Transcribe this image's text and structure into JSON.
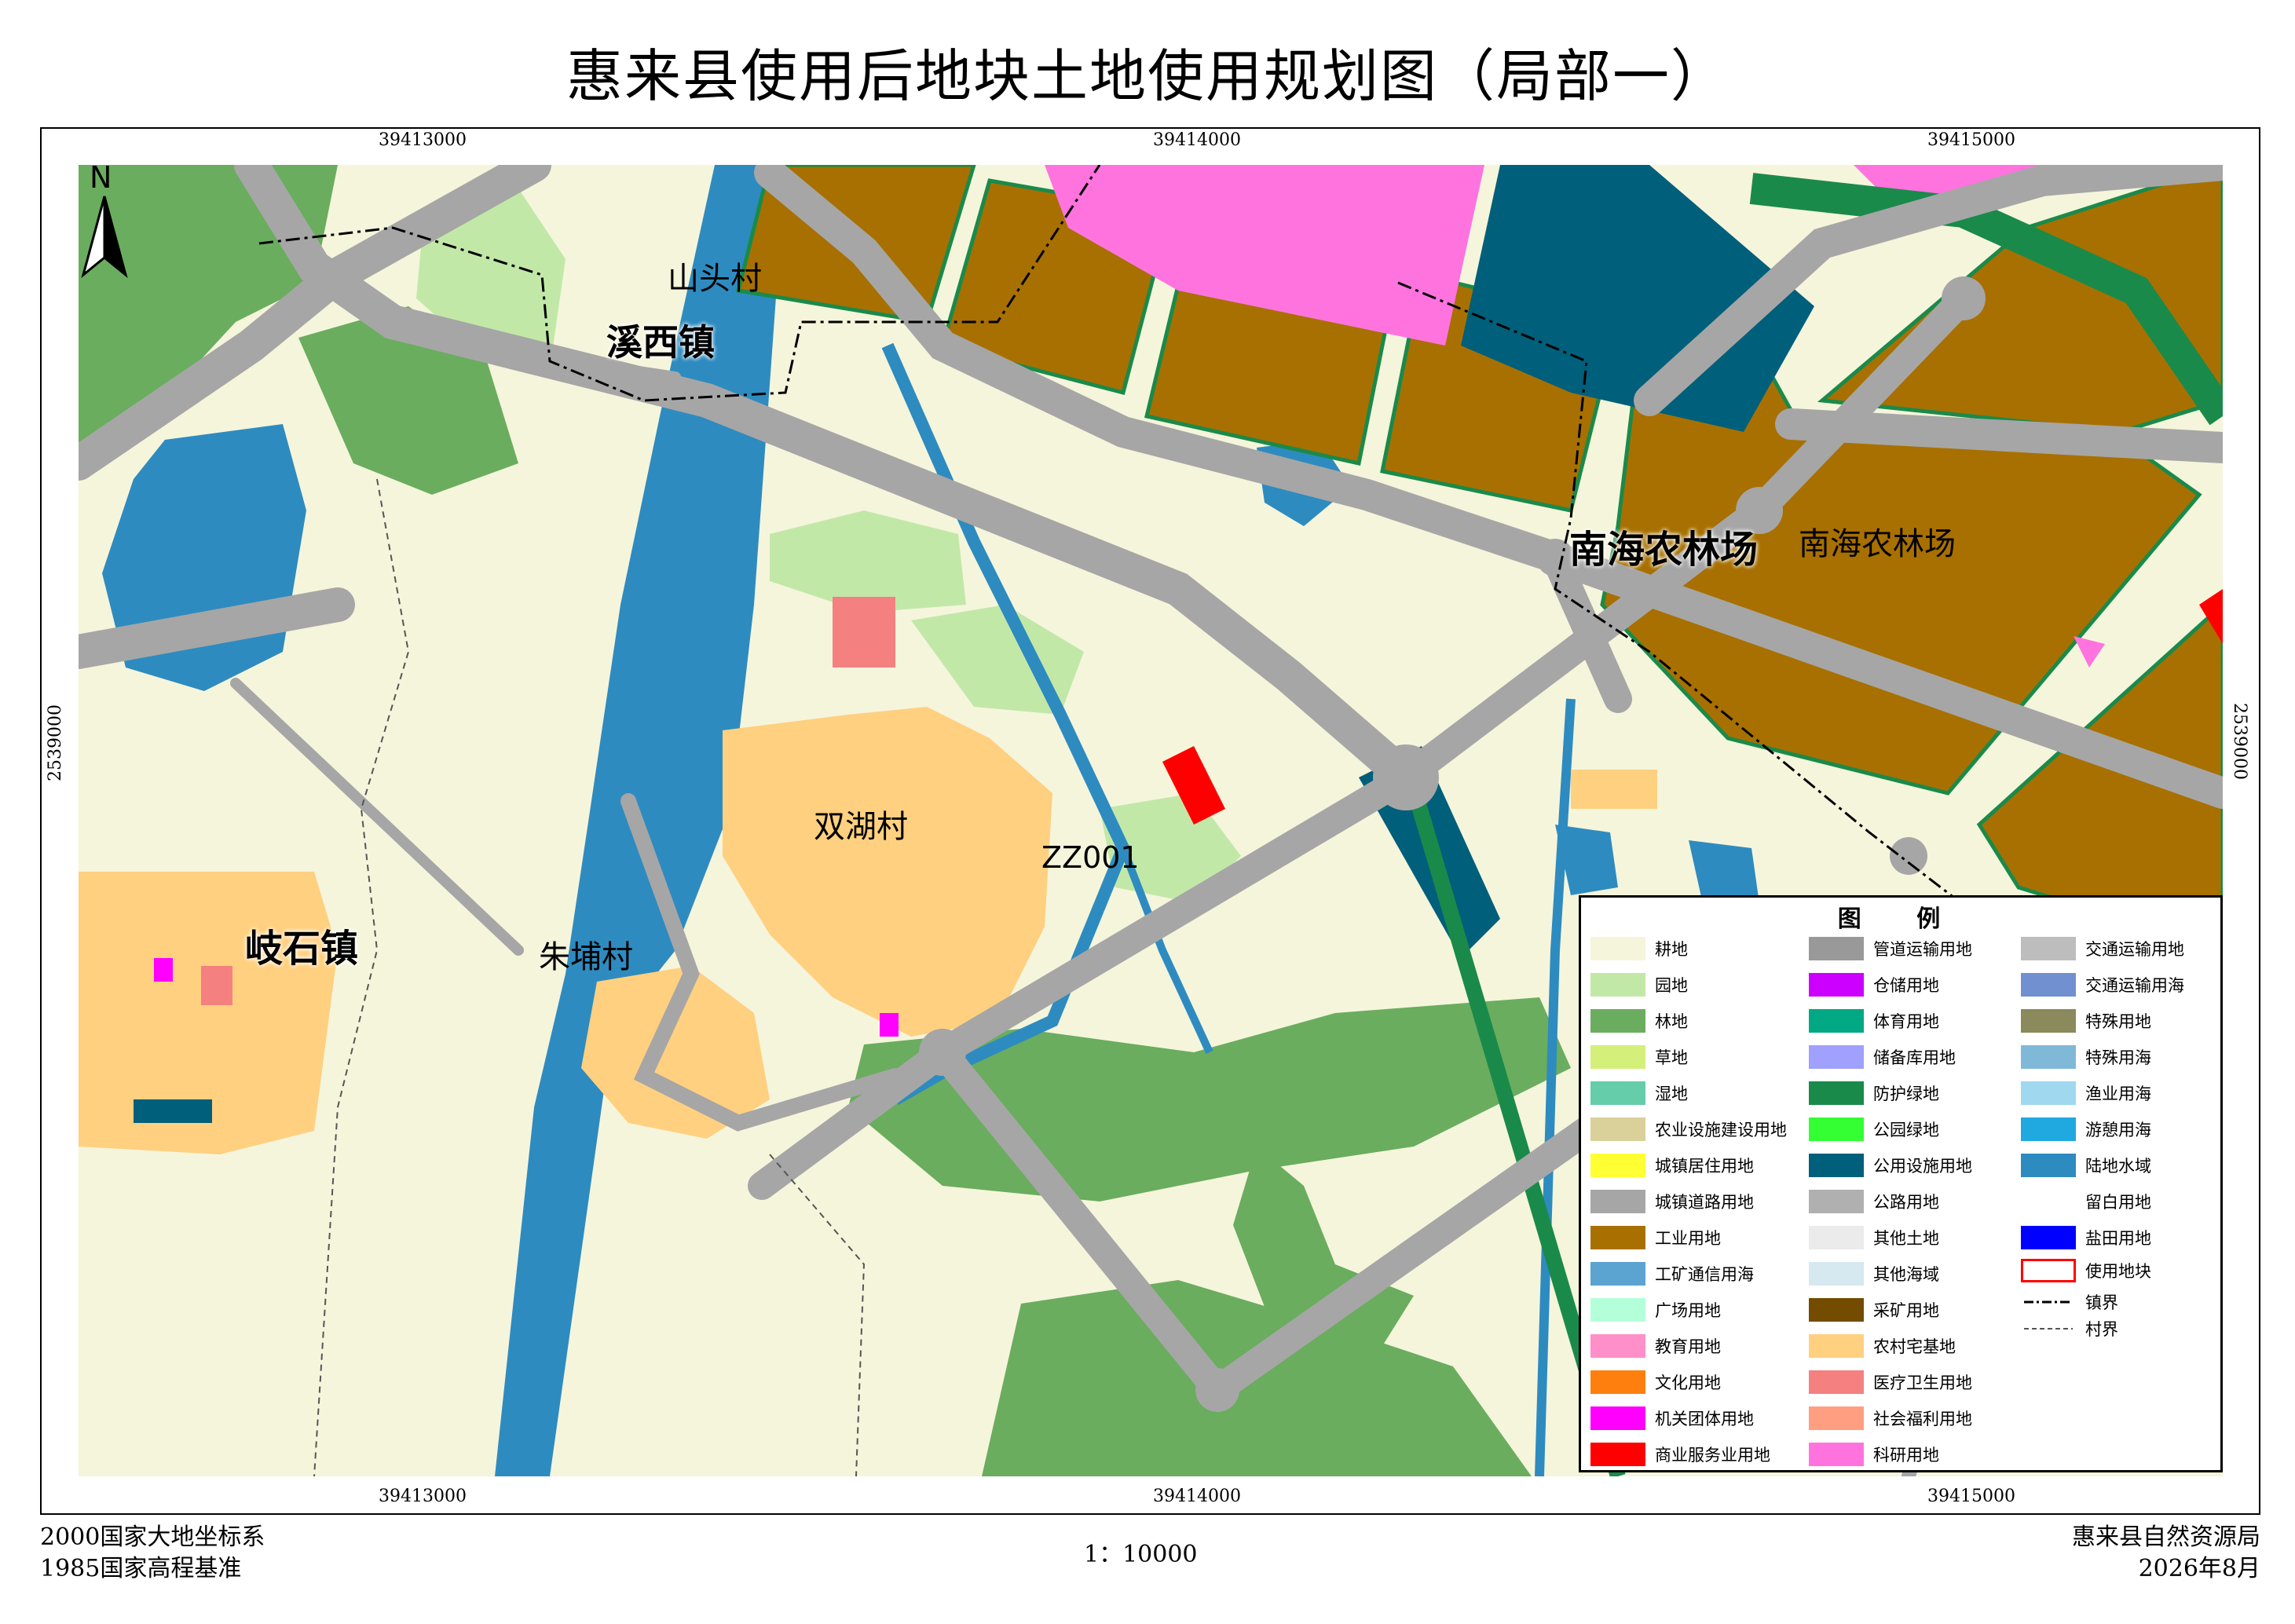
{
  "title": "惠来县使用后地块土地使用规划图（局部一）",
  "map": {
    "x_coords": [
      "39413000",
      "39414000",
      "39415000"
    ],
    "y_coords": [
      "2539000"
    ],
    "labels": {
      "xixi_town": "溪西镇",
      "shantou_village": "山头村",
      "nanhai_farm_bold": "南海农林场",
      "nanhai_farm": "南海农林场",
      "shuanghu_village": "双湖村",
      "parcel_id": "ZZ001",
      "qishi_town": "岐石镇",
      "zhupu_village": "朱埔村"
    },
    "north_label": "N"
  },
  "legend": {
    "title": "图 例",
    "col1": [
      {
        "label": "耕地",
        "color": "#f5f5dc"
      },
      {
        "label": "园地",
        "color": "#c2e8a8"
      },
      {
        "label": "林地",
        "color": "#6aad5e"
      },
      {
        "label": "草地",
        "color": "#d4f07a"
      },
      {
        "label": "湿地",
        "color": "#66cdaa"
      },
      {
        "label": "农业设施建设用地",
        "color": "#d9d09a"
      },
      {
        "label": "城镇居住用地",
        "color": "#ffff33"
      },
      {
        "label": "城镇道路用地",
        "color": "#a6a6a6"
      },
      {
        "label": "工业用地",
        "color": "#a87000"
      },
      {
        "label": "工矿通信用海",
        "color": "#5ba3d0"
      },
      {
        "label": "广场用地",
        "color": "#b3ffd9"
      },
      {
        "label": "教育用地",
        "color": "#ff8fc8"
      },
      {
        "label": "文化用地",
        "color": "#ff7f0e"
      },
      {
        "label": "机关团体用地",
        "color": "#ff00ff"
      },
      {
        "label": "商业服务业用地",
        "color": "#ff0000"
      }
    ],
    "col2": [
      {
        "label": "管道运输用地",
        "color": "#999999"
      },
      {
        "label": "仓储用地",
        "color": "#cc00ff"
      },
      {
        "label": "体育用地",
        "color": "#00a884"
      },
      {
        "label": "储备库用地",
        "color": "#a0a0ff"
      },
      {
        "label": "防护绿地",
        "color": "#1a8a4a"
      },
      {
        "label": "公园绿地",
        "color": "#33ff33"
      },
      {
        "label": "公用设施用地",
        "color": "#005f7a"
      },
      {
        "label": "公路用地",
        "color": "#b0b0b0"
      },
      {
        "label": "其他土地",
        "color": "#ebebeb"
      },
      {
        "label": "其他海域",
        "color": "#d6e8f0"
      },
      {
        "label": "采矿用地",
        "color": "#734c00"
      },
      {
        "label": "农村宅基地",
        "color": "#ffd080"
      },
      {
        "label": "医疗卫生用地",
        "color": "#f58080"
      },
      {
        "label": "社会福利用地",
        "color": "#ff9e80"
      },
      {
        "label": "科研用地",
        "color": "#ff73df"
      }
    ],
    "col3": [
      {
        "label": "交通运输用地",
        "color": "#bdbdbd"
      },
      {
        "label": "交通运输用海",
        "color": "#7090d0"
      },
      {
        "label": "特殊用地",
        "color": "#8a8a5c"
      },
      {
        "label": "特殊用海",
        "color": "#80b8d8"
      },
      {
        "label": "渔业用海",
        "color": "#a0d8ef"
      },
      {
        "label": "游憩用海",
        "color": "#20a8e0"
      },
      {
        "label": "陆地水域",
        "color": "#2e8bc0"
      },
      {
        "label": "留白用地",
        "color": "#ffffff"
      },
      {
        "label": "盐田用地",
        "color": "#0000ff"
      },
      {
        "label": "使用地块",
        "color": "#ff0000"
      },
      {
        "label": "镇界",
        "color": "#000000"
      },
      {
        "label": "村界",
        "color": "#555555"
      }
    ]
  },
  "footer": {
    "datum": "2000国家大地坐标系",
    "elevation": "1985国家高程基准",
    "scale": "1：10000",
    "org": "惠来县自然资源局",
    "date": "2026年8月"
  }
}
